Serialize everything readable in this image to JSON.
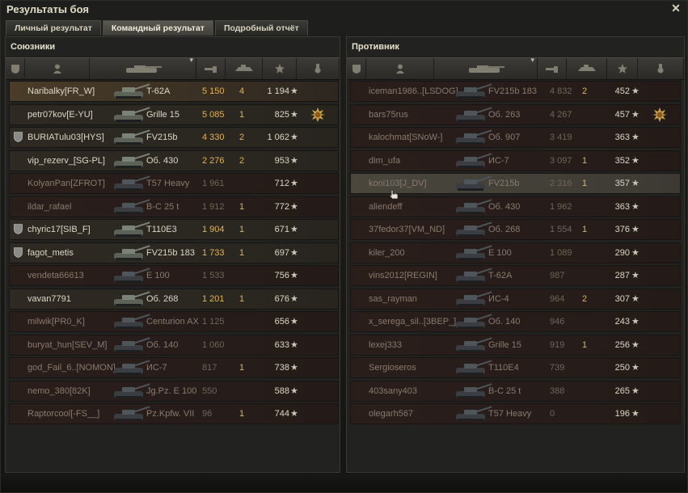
{
  "window": {
    "title": "Результаты боя",
    "close_icon": "close-icon"
  },
  "tabs": [
    {
      "label": "Личный результат",
      "active": false
    },
    {
      "label": "Командный результат",
      "active": true
    },
    {
      "label": "Подробный отчёт",
      "active": false
    }
  ],
  "columns": [
    "squad-icon",
    "player-icon",
    "tank-icon",
    "damage-icon",
    "kills-icon",
    "xp-star-icon",
    "medal-icon"
  ],
  "allies": {
    "title": "Союзники",
    "rows": [
      {
        "player": "Naribalky[FR_W]",
        "vehicle": "T-62A",
        "damage": "5 150",
        "kills": "4",
        "xp": "1 194",
        "squad": false,
        "dead": false,
        "self": true,
        "medal": false
      },
      {
        "player": "petr07kov[E-YU]",
        "vehicle": "Grille 15",
        "damage": "5 085",
        "kills": "1",
        "xp": "825",
        "squad": false,
        "dead": false,
        "medal": true
      },
      {
        "player": "BURIATulu03[HYS]",
        "vehicle": "FV215b",
        "damage": "4 330",
        "kills": "2",
        "xp": "1 062",
        "squad": true,
        "dead": false,
        "medal": false
      },
      {
        "player": "vip_rezerv_[SG-PL]",
        "vehicle": "Об. 430",
        "damage": "2 276",
        "kills": "2",
        "xp": "953",
        "squad": false,
        "dead": false,
        "medal": false
      },
      {
        "player": "KolyanPan[ZFROT]",
        "vehicle": "T57 Heavy",
        "damage": "1 961",
        "kills": "",
        "xp": "712",
        "squad": false,
        "dead": true,
        "medal": false
      },
      {
        "player": "ildar_rafael",
        "vehicle": "B-C 25 t",
        "damage": "1 912",
        "kills": "1",
        "xp": "772",
        "squad": false,
        "dead": true,
        "medal": false
      },
      {
        "player": "chyric17[SIB_F]",
        "vehicle": "T110E3",
        "damage": "1 904",
        "kills": "1",
        "xp": "671",
        "squad": true,
        "dead": false,
        "medal": false
      },
      {
        "player": "fagot_metis",
        "vehicle": "FV215b 183",
        "damage": "1 733",
        "kills": "1",
        "xp": "697",
        "squad": true,
        "dead": false,
        "medal": false
      },
      {
        "player": "vendeta66613",
        "vehicle": "E 100",
        "damage": "1 533",
        "kills": "",
        "xp": "756",
        "squad": false,
        "dead": true,
        "medal": false
      },
      {
        "player": "vavan7791",
        "vehicle": "Об. 268",
        "damage": "1 201",
        "kills": "1",
        "xp": "676",
        "squad": false,
        "dead": false,
        "medal": false
      },
      {
        "player": "milwik[PR0_K]",
        "vehicle": "Centurion AX",
        "damage": "1 125",
        "kills": "",
        "xp": "656",
        "squad": false,
        "dead": true,
        "medal": false
      },
      {
        "player": "buryat_hun[SEV_M]",
        "vehicle": "Об. 140",
        "damage": "1 060",
        "kills": "",
        "xp": "633",
        "squad": false,
        "dead": true,
        "medal": false
      },
      {
        "player": "god_Fail_6..[NOMON]",
        "vehicle": "ИС-7",
        "damage": "817",
        "kills": "1",
        "xp": "738",
        "squad": false,
        "dead": true,
        "medal": false
      },
      {
        "player": "nemo_380[82K]",
        "vehicle": "Jg.Pz. E 100",
        "damage": "550",
        "kills": "",
        "xp": "588",
        "squad": false,
        "dead": true,
        "medal": false
      },
      {
        "player": "Raptorcool[-FS__]",
        "vehicle": "Pz.Kpfw. VII",
        "damage": "96",
        "kills": "1",
        "xp": "744",
        "squad": false,
        "dead": true,
        "medal": false
      }
    ]
  },
  "enemies": {
    "title": "Противник",
    "rows": [
      {
        "player": "iceman1986..[LSDOG]",
        "vehicle": "FV215b 183",
        "damage": "4 832",
        "kills": "2",
        "xp": "452",
        "dead": true,
        "medal": false
      },
      {
        "player": "bars75rus",
        "vehicle": "Об. 263",
        "damage": "4 267",
        "kills": "",
        "xp": "457",
        "dead": true,
        "medal": true
      },
      {
        "player": "kalochmat[SNoW-]",
        "vehicle": "Об. 907",
        "damage": "3 419",
        "kills": "",
        "xp": "363",
        "dead": true,
        "medal": false
      },
      {
        "player": "dim_ufa",
        "vehicle": "ИС-7",
        "damage": "3 097",
        "kills": "1",
        "xp": "352",
        "dead": true,
        "medal": false
      },
      {
        "player": "koni103[J_DV]",
        "vehicle": "FV215b",
        "damage": "2 316",
        "kills": "1",
        "xp": "357",
        "dead": true,
        "hover": true,
        "medal": false
      },
      {
        "player": "aliendeff",
        "vehicle": "Об. 430",
        "damage": "1 962",
        "kills": "",
        "xp": "363",
        "dead": true,
        "medal": false
      },
      {
        "player": "37fedor37[VM_ND]",
        "vehicle": "Об. 268",
        "damage": "1 554",
        "kills": "1",
        "xp": "376",
        "dead": true,
        "medal": false
      },
      {
        "player": "kiler_200",
        "vehicle": "E 100",
        "damage": "1 089",
        "kills": "",
        "xp": "290",
        "dead": true,
        "medal": false
      },
      {
        "player": "vins2012[REGIN]",
        "vehicle": "T-62A",
        "damage": "987",
        "kills": "",
        "xp": "287",
        "dead": true,
        "medal": false
      },
      {
        "player": "sas_rayman",
        "vehicle": "ИС-4",
        "damage": "964",
        "kills": "2",
        "xp": "307",
        "dead": true,
        "medal": false
      },
      {
        "player": "x_serega_sil..[3BEP_]",
        "vehicle": "Об. 140",
        "damage": "946",
        "kills": "",
        "xp": "243",
        "dead": true,
        "medal": false
      },
      {
        "player": "lexej333",
        "vehicle": "Grille 15",
        "damage": "919",
        "kills": "1",
        "xp": "256",
        "dead": true,
        "medal": false
      },
      {
        "player": "Sergioseros",
        "vehicle": "T110E4",
        "damage": "739",
        "kills": "",
        "xp": "250",
        "dead": true,
        "medal": false
      },
      {
        "player": "403sany403",
        "vehicle": "B-C 25 t",
        "damage": "388",
        "kills": "",
        "xp": "265",
        "dead": true,
        "medal": false
      },
      {
        "player": "olegarh567",
        "vehicle": "T57 Heavy",
        "damage": "0",
        "kills": "",
        "xp": "196",
        "dead": true,
        "medal": false
      }
    ]
  },
  "colors": {
    "damage": "#e1b25c",
    "dead_text": "#8a7a6e",
    "accent": "#e2ddc9"
  }
}
